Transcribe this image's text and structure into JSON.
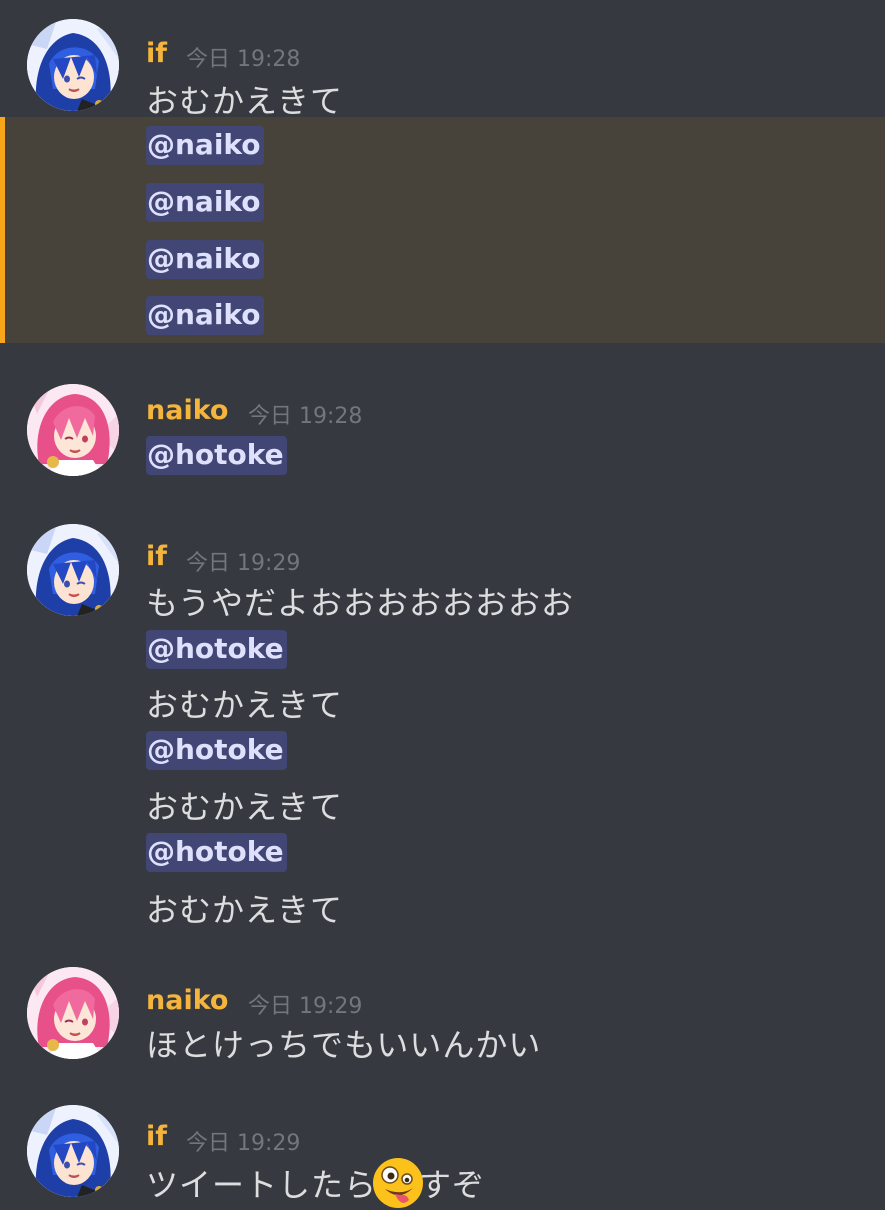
{
  "messages": [
    {
      "author": "if",
      "time": "今日 19:28",
      "lines": [
        "おむかえきて"
      ],
      "mentions": [
        "@naiko",
        "@naiko",
        "@naiko",
        "@naiko"
      ]
    },
    {
      "author": "naiko",
      "time": "今日 19:28",
      "mentions": [
        "@hotoke"
      ]
    },
    {
      "author": "if",
      "time": "今日 19:29",
      "lines": [
        "もうやだよおおおおおおおお",
        "おむかえきて",
        "おむかえきて",
        "おむかえきて"
      ],
      "mentions": [
        "@hotoke",
        "@hotoke",
        "@hotoke"
      ]
    },
    {
      "author": "naiko",
      "time": "今日 19:29",
      "lines": [
        "ほとけっちでもいいんかい"
      ]
    },
    {
      "author": "if",
      "time": "今日 19:29",
      "line_before_emoji": "ツイートしたら",
      "emoji": "zany-face-emoji",
      "line_after_emoji": "すぞ"
    }
  ],
  "colors": {
    "background": "#36393f",
    "username": "#f5b53d",
    "timestamp": "#72767d",
    "mention_bg": "#414675",
    "mention_text": "#dee0fc",
    "highlight_bg": "#47433a",
    "highlight_border": "#faa61a"
  }
}
